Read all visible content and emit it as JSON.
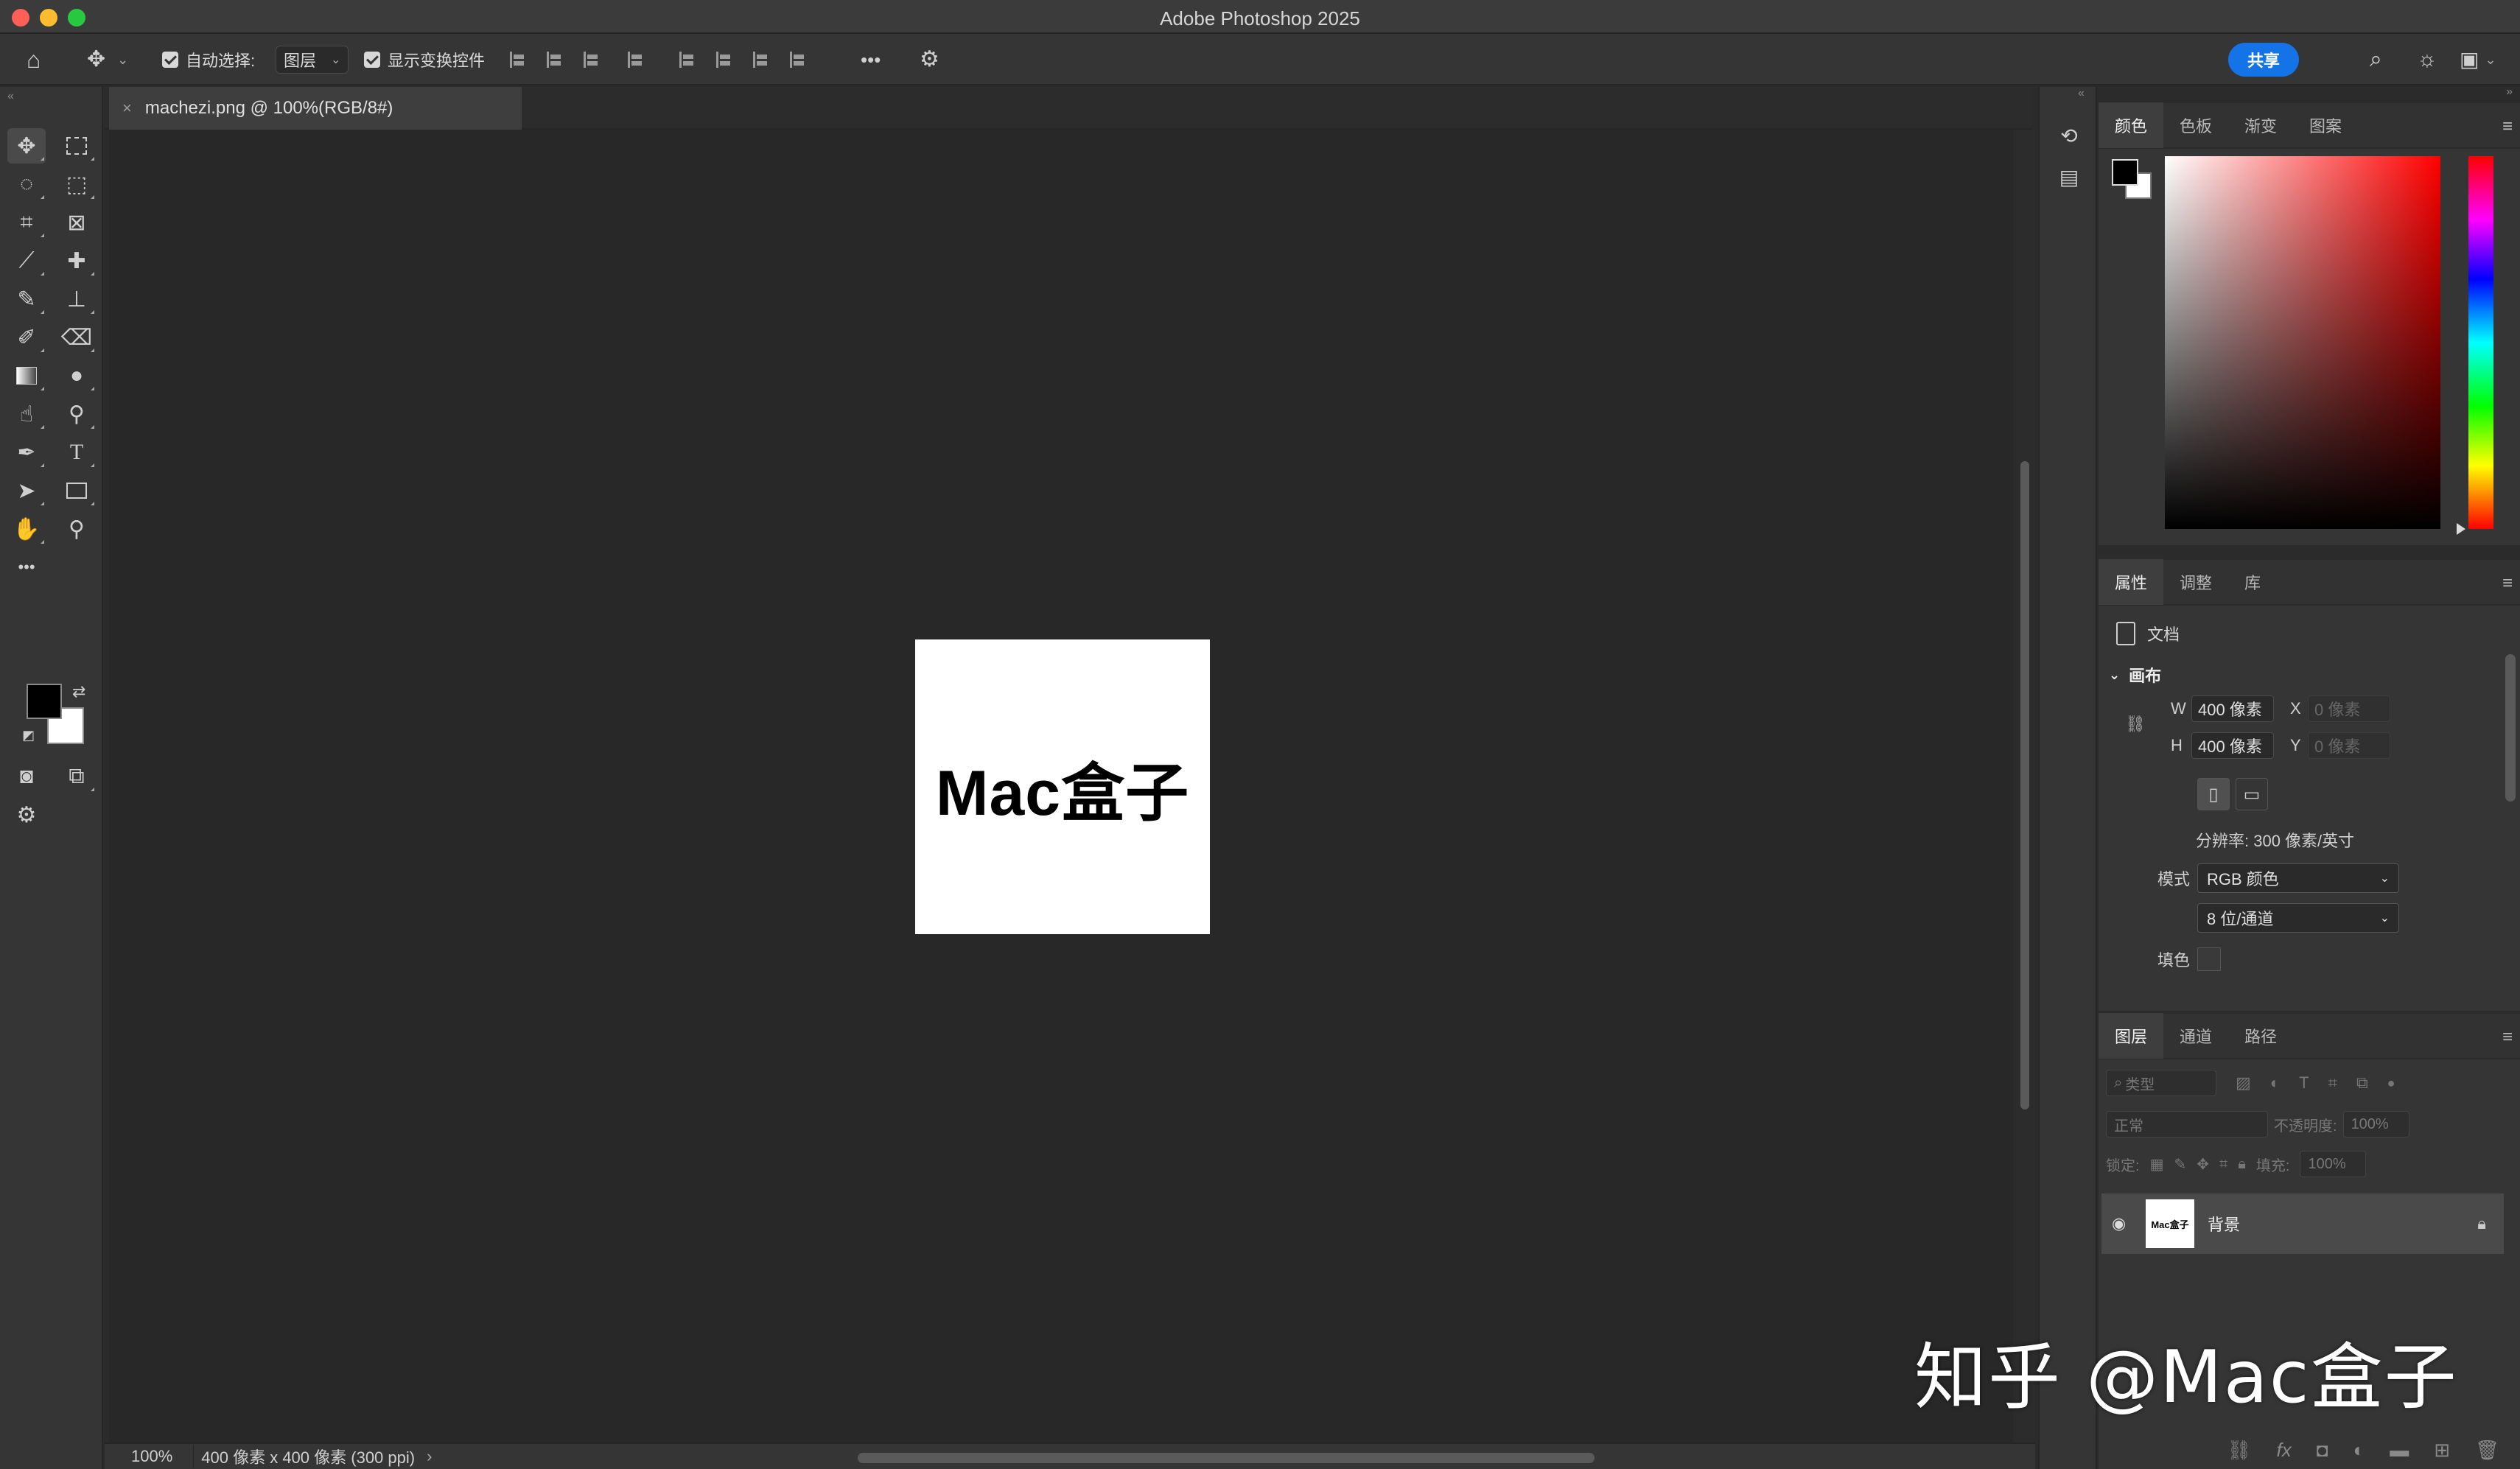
{
  "app": {
    "title": "Adobe Photoshop 2025"
  },
  "options_bar": {
    "auto_select_label": "自动选择:",
    "auto_select_value": "图层",
    "show_transform_label": "显示变换控件",
    "more_label": "•••",
    "share_label": "共享"
  },
  "toolbar": {
    "more_label": "•••"
  },
  "document": {
    "tab_title": "machezi.png @ 100%(RGB/8#)",
    "canvas_text": "Mac盒子",
    "zoom": "100%",
    "info": "400 像素 x 400 像素 (300 ppi)"
  },
  "color_panel": {
    "tabs": [
      "颜色",
      "色板",
      "渐变",
      "图案"
    ]
  },
  "properties_panel": {
    "tabs": [
      "属性",
      "调整",
      "库"
    ],
    "doc_label": "文档",
    "canvas_header": "画布",
    "w_label": "W",
    "w_value": "400 像素",
    "x_label": "X",
    "x_placeholder": "0 像素",
    "h_label": "H",
    "h_value": "400 像素",
    "y_label": "Y",
    "y_placeholder": "0 像素",
    "resolution": "分辨率: 300 像素/英寸",
    "mode_label": "模式",
    "mode_value": "RGB 颜色",
    "depth_value": "8 位/通道",
    "fill_label": "填色"
  },
  "layers_panel": {
    "tabs": [
      "图层",
      "通道",
      "路径"
    ],
    "filter_placeholder": "类型",
    "blend_mode": "正常",
    "opacity_label": "不透明度:",
    "opacity_value": "100%",
    "lock_label": "锁定:",
    "fill_label": "填充:",
    "fill_value": "100%",
    "layers": [
      {
        "name": "背景",
        "thumb_text": "Mac盒子",
        "visible": true,
        "locked": true
      }
    ],
    "footer_icons": [
      "link-icon",
      "fx-icon",
      "mask-icon",
      "adjustment-icon",
      "folder-icon",
      "new-layer-icon",
      "trash-icon"
    ]
  },
  "watermark": {
    "text": "知乎 @Mac盒子"
  },
  "colors": {
    "share_button": "#1473e6",
    "panel_bg": "#353535",
    "canvas_bg": "#282828"
  }
}
